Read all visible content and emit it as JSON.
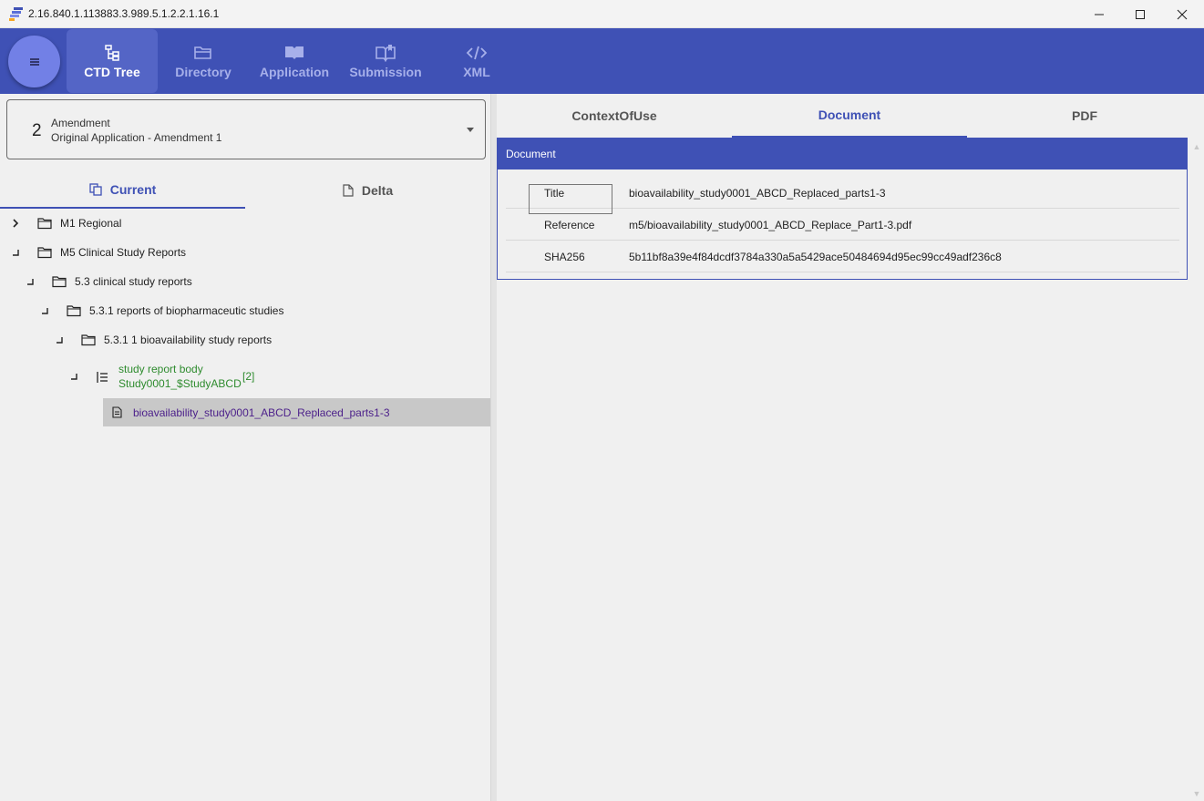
{
  "window": {
    "title": "2.16.840.1.113883.3.989.5.1.2.2.1.16.1",
    "app_icon": "app-logo-icon",
    "controls": [
      "minimize-icon",
      "maximize-icon",
      "close-icon"
    ]
  },
  "nav": {
    "menu_icon": "hamburger-icon",
    "tabs": [
      {
        "label": "CTD Tree",
        "icon": "tree-icon",
        "active": true
      },
      {
        "label": "Directory",
        "icon": "folder-open-icon",
        "active": false
      },
      {
        "label": "Application",
        "icon": "book-icon",
        "active": false
      },
      {
        "label": "Submission",
        "icon": "open-book-icon",
        "active": false
      },
      {
        "label": "XML",
        "icon": "code-icon",
        "active": false
      }
    ]
  },
  "selector": {
    "number": "2",
    "type": "Amendment",
    "name": "Original Application - Amendment 1"
  },
  "left_tabs": {
    "current": "Current",
    "delta": "Delta"
  },
  "tree": {
    "m1": "M1 Regional",
    "m5": "M5 Clinical Study Reports",
    "s53": "5.3 clinical study reports",
    "s531": "5.3.1 reports of biopharmaceutic studies",
    "s5311": "5.3.1 1 bioavailability study reports",
    "srb_line1": "study report body",
    "srb_line2": "Study0001_$StudyABCD",
    "srb_count": "[2]",
    "doc": "bioavailability_study0001_ABCD_Replaced_parts1-3"
  },
  "right_tabs": {
    "context": "ContextOfUse",
    "document": "Document",
    "pdf": "PDF"
  },
  "document": {
    "header": "Document",
    "title_key": "Title",
    "title_value": "bioavailability_study0001_ABCD_Replaced_parts1-3",
    "reference_key": "Reference",
    "reference_value": "m5/bioavailability_study0001_ABCD_Replace_Part1-3.pdf",
    "sha_key": "SHA256",
    "sha_value": "5b11bf8a39e4f84dcdf3784a330a5a5429ace50484694d95ec99cc49adf236c8"
  },
  "colors": {
    "primary": "#3f51b5",
    "fab": "#7280e6",
    "leaf_green": "#2e8b2e",
    "doc_purple": "#4b1f8a"
  }
}
